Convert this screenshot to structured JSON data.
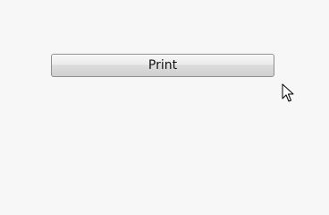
{
  "main": {
    "print_button_label": "Print"
  },
  "cursor": {
    "icon": "arrow-pointer-icon"
  }
}
